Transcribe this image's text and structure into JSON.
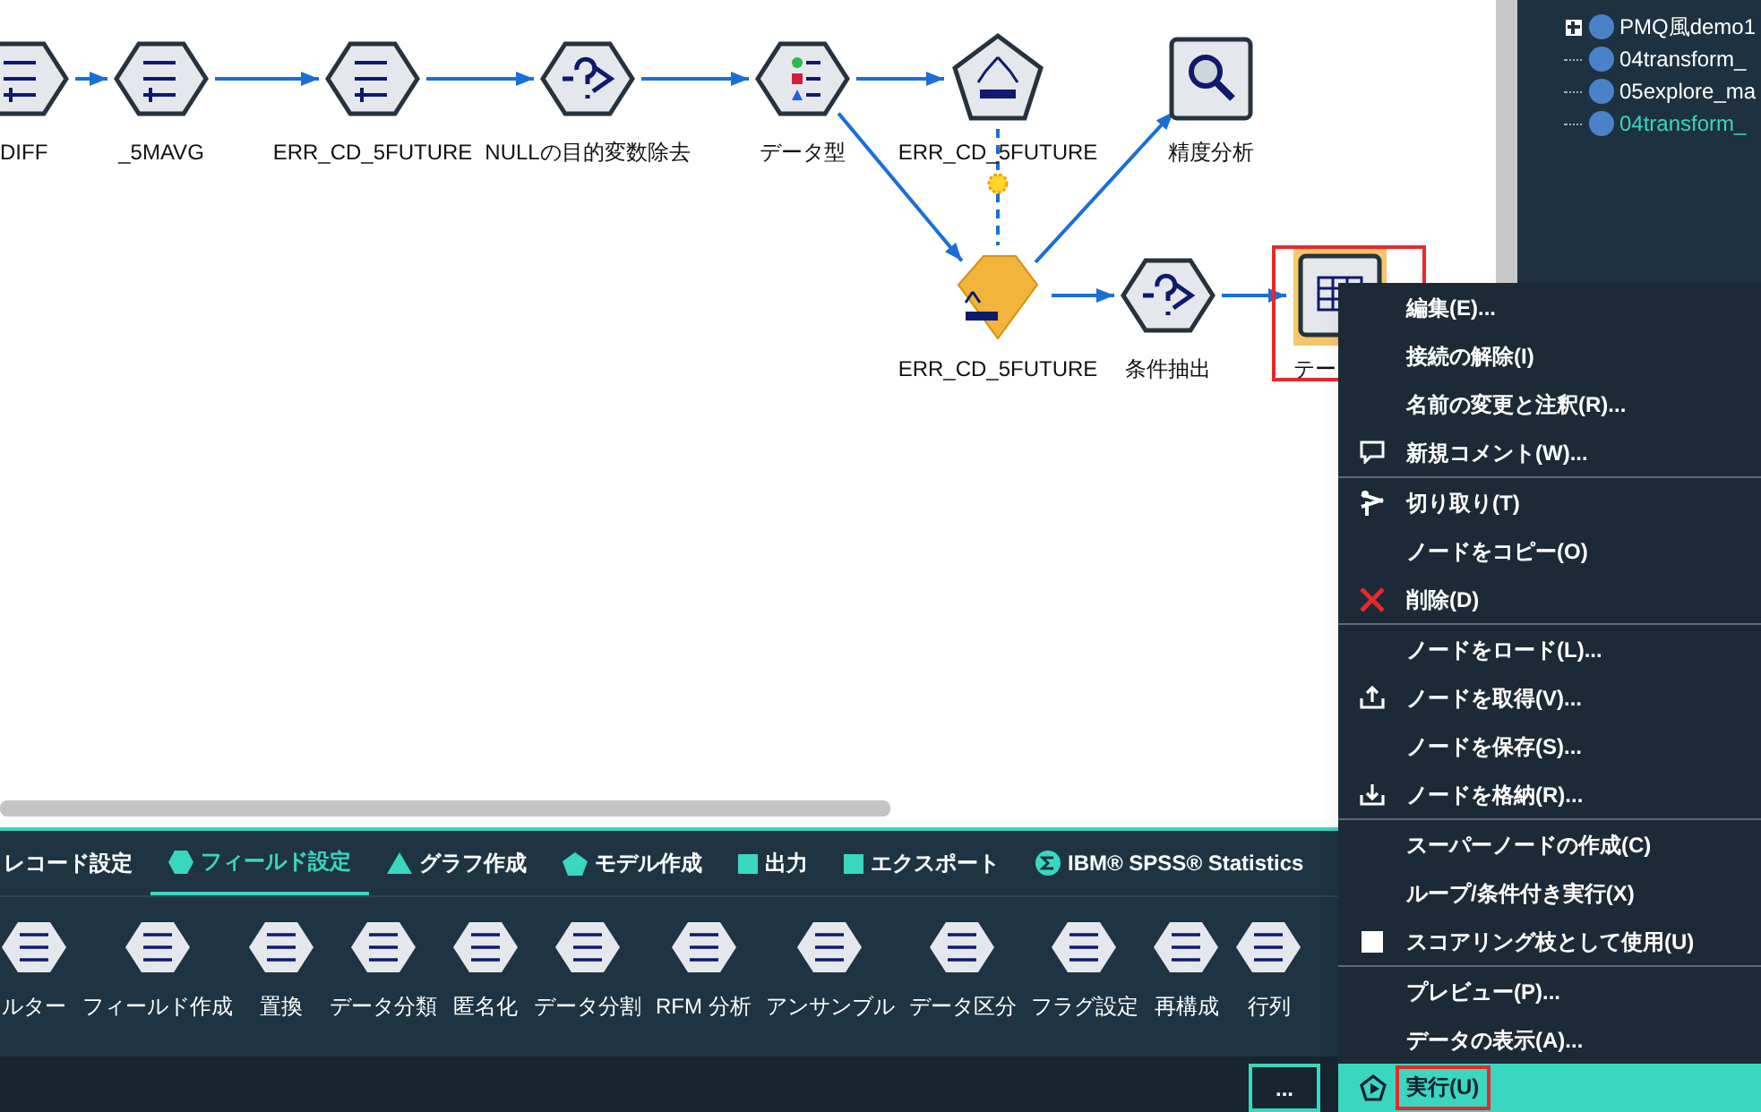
{
  "stream": {
    "nodes": [
      {
        "label": "DIFF",
        "kind": "derive",
        "selected": false,
        "annotated": false
      },
      {
        "label": "_5MAVG",
        "kind": "derive",
        "selected": false,
        "annotated": false
      },
      {
        "label": "ERR_CD_5FUTURE",
        "kind": "derive",
        "selected": false,
        "annotated": false
      },
      {
        "label": "NULLの目的変数除去",
        "kind": "select",
        "selected": false,
        "annotated": false
      },
      {
        "label": "データ型",
        "kind": "type",
        "selected": false,
        "annotated": false
      },
      {
        "label": "ERR_CD_5FUTURE",
        "kind": "chaid",
        "selected": false,
        "annotated": false
      },
      {
        "label": "精度分析",
        "kind": "analysis",
        "selected": false,
        "annotated": false
      },
      {
        "label": "ERR_CD_5FUTURE",
        "kind": "model",
        "selected": false,
        "annotated": false
      },
      {
        "label": "条件抽出",
        "kind": "select",
        "selected": false,
        "annotated": false
      },
      {
        "label": "テー",
        "kind": "table",
        "selected": true,
        "annotated": true
      }
    ],
    "edges_drawn": true
  },
  "tree": [
    {
      "label": "PMQ風demo1",
      "kind": "branch",
      "selected": false
    },
    {
      "label": "04transform_",
      "kind": "leaf",
      "selected": false
    },
    {
      "label": "05explore_ma",
      "kind": "leaf",
      "selected": false
    },
    {
      "label": "04transform_",
      "kind": "leaf",
      "selected": true
    }
  ],
  "palette": {
    "tabs": [
      {
        "label": "レコード設定",
        "kind": "none",
        "selected": false
      },
      {
        "label": "フィールド設定",
        "kind": "hexagon",
        "selected": true
      },
      {
        "label": "グラフ作成",
        "kind": "triangle",
        "selected": false
      },
      {
        "label": "モデル作成",
        "kind": "pentagon",
        "selected": false
      },
      {
        "label": "出力",
        "kind": "square",
        "selected": false
      },
      {
        "label": "エクスポート",
        "kind": "square",
        "selected": false
      },
      {
        "label": "IBM® SPSS® Statistics",
        "kind": "sigma",
        "selected": false
      }
    ],
    "nodes": [
      "ルター",
      "フィールド作成",
      "置換",
      "データ分類",
      "匿名化",
      "データ分割",
      "RFM 分析",
      "アンサンブル",
      "データ区分",
      "フラグ設定",
      "再構成",
      "行列"
    ]
  },
  "status_bar": {
    "button": "..."
  },
  "context_menu": {
    "groups": [
      [
        {
          "label": "編集(E)...",
          "kind": "plain",
          "selected": false,
          "annotated": false
        },
        {
          "label": "接続の解除(I)",
          "kind": "plain",
          "selected": false,
          "annotated": false
        },
        {
          "label": "名前の変更と注釈(R)...",
          "kind": "plain",
          "selected": false,
          "annotated": false
        },
        {
          "label": "新規コメント(W)...",
          "kind": "comment",
          "selected": false,
          "annotated": false
        }
      ],
      [
        {
          "label": "切り取り(T)",
          "kind": "cut",
          "selected": false,
          "annotated": false
        },
        {
          "label": "ノードをコピー(O)",
          "kind": "plain",
          "selected": false,
          "annotated": false
        },
        {
          "label": "削除(D)",
          "kind": "delete",
          "selected": false,
          "annotated": false
        }
      ],
      [
        {
          "label": "ノードをロード(L)...",
          "kind": "plain",
          "selected": false,
          "annotated": false
        },
        {
          "label": "ノードを取得(V)...",
          "kind": "upload",
          "selected": false,
          "annotated": false
        },
        {
          "label": "ノードを保存(S)...",
          "kind": "plain",
          "selected": false,
          "annotated": false
        },
        {
          "label": "ノードを格納(R)...",
          "kind": "download",
          "selected": false,
          "annotated": false
        }
      ],
      [
        {
          "label": "スーパーノードの作成(C)",
          "kind": "plain",
          "selected": false,
          "annotated": false
        },
        {
          "label": "ループ/条件付き実行(X)",
          "kind": "plain",
          "selected": false,
          "annotated": false
        },
        {
          "label": "スコアリング枝として使用(U)",
          "kind": "square",
          "selected": false,
          "annotated": false
        }
      ],
      [
        {
          "label": "プレビュー(P)...",
          "kind": "plain",
          "selected": false,
          "annotated": false
        },
        {
          "label": "データの表示(A)...",
          "kind": "plain",
          "selected": false,
          "annotated": false
        },
        {
          "label": "実行(U)",
          "kind": "run",
          "selected": true,
          "annotated": true
        }
      ]
    ]
  }
}
